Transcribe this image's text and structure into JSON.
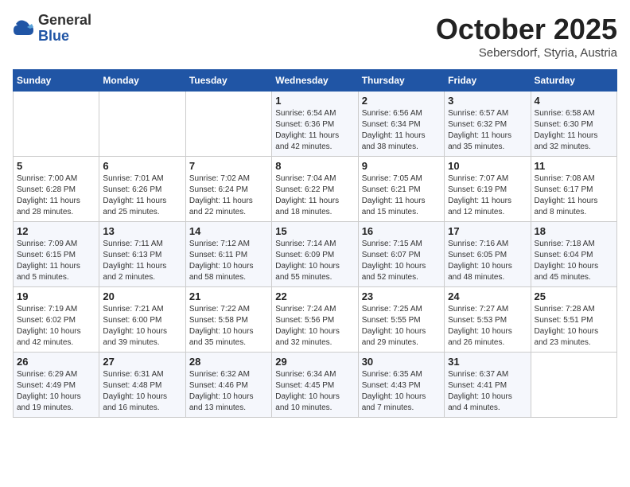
{
  "header": {
    "logo_line1": "General",
    "logo_line2": "Blue",
    "month": "October 2025",
    "location": "Sebersdorf, Styria, Austria"
  },
  "weekdays": [
    "Sunday",
    "Monday",
    "Tuesday",
    "Wednesday",
    "Thursday",
    "Friday",
    "Saturday"
  ],
  "weeks": [
    [
      {
        "day": "",
        "info": ""
      },
      {
        "day": "",
        "info": ""
      },
      {
        "day": "",
        "info": ""
      },
      {
        "day": "1",
        "info": "Sunrise: 6:54 AM\nSunset: 6:36 PM\nDaylight: 11 hours\nand 42 minutes."
      },
      {
        "day": "2",
        "info": "Sunrise: 6:56 AM\nSunset: 6:34 PM\nDaylight: 11 hours\nand 38 minutes."
      },
      {
        "day": "3",
        "info": "Sunrise: 6:57 AM\nSunset: 6:32 PM\nDaylight: 11 hours\nand 35 minutes."
      },
      {
        "day": "4",
        "info": "Sunrise: 6:58 AM\nSunset: 6:30 PM\nDaylight: 11 hours\nand 32 minutes."
      }
    ],
    [
      {
        "day": "5",
        "info": "Sunrise: 7:00 AM\nSunset: 6:28 PM\nDaylight: 11 hours\nand 28 minutes."
      },
      {
        "day": "6",
        "info": "Sunrise: 7:01 AM\nSunset: 6:26 PM\nDaylight: 11 hours\nand 25 minutes."
      },
      {
        "day": "7",
        "info": "Sunrise: 7:02 AM\nSunset: 6:24 PM\nDaylight: 11 hours\nand 22 minutes."
      },
      {
        "day": "8",
        "info": "Sunrise: 7:04 AM\nSunset: 6:22 PM\nDaylight: 11 hours\nand 18 minutes."
      },
      {
        "day": "9",
        "info": "Sunrise: 7:05 AM\nSunset: 6:21 PM\nDaylight: 11 hours\nand 15 minutes."
      },
      {
        "day": "10",
        "info": "Sunrise: 7:07 AM\nSunset: 6:19 PM\nDaylight: 11 hours\nand 12 minutes."
      },
      {
        "day": "11",
        "info": "Sunrise: 7:08 AM\nSunset: 6:17 PM\nDaylight: 11 hours\nand 8 minutes."
      }
    ],
    [
      {
        "day": "12",
        "info": "Sunrise: 7:09 AM\nSunset: 6:15 PM\nDaylight: 11 hours\nand 5 minutes."
      },
      {
        "day": "13",
        "info": "Sunrise: 7:11 AM\nSunset: 6:13 PM\nDaylight: 11 hours\nand 2 minutes."
      },
      {
        "day": "14",
        "info": "Sunrise: 7:12 AM\nSunset: 6:11 PM\nDaylight: 10 hours\nand 58 minutes."
      },
      {
        "day": "15",
        "info": "Sunrise: 7:14 AM\nSunset: 6:09 PM\nDaylight: 10 hours\nand 55 minutes."
      },
      {
        "day": "16",
        "info": "Sunrise: 7:15 AM\nSunset: 6:07 PM\nDaylight: 10 hours\nand 52 minutes."
      },
      {
        "day": "17",
        "info": "Sunrise: 7:16 AM\nSunset: 6:05 PM\nDaylight: 10 hours\nand 48 minutes."
      },
      {
        "day": "18",
        "info": "Sunrise: 7:18 AM\nSunset: 6:04 PM\nDaylight: 10 hours\nand 45 minutes."
      }
    ],
    [
      {
        "day": "19",
        "info": "Sunrise: 7:19 AM\nSunset: 6:02 PM\nDaylight: 10 hours\nand 42 minutes."
      },
      {
        "day": "20",
        "info": "Sunrise: 7:21 AM\nSunset: 6:00 PM\nDaylight: 10 hours\nand 39 minutes."
      },
      {
        "day": "21",
        "info": "Sunrise: 7:22 AM\nSunset: 5:58 PM\nDaylight: 10 hours\nand 35 minutes."
      },
      {
        "day": "22",
        "info": "Sunrise: 7:24 AM\nSunset: 5:56 PM\nDaylight: 10 hours\nand 32 minutes."
      },
      {
        "day": "23",
        "info": "Sunrise: 7:25 AM\nSunset: 5:55 PM\nDaylight: 10 hours\nand 29 minutes."
      },
      {
        "day": "24",
        "info": "Sunrise: 7:27 AM\nSunset: 5:53 PM\nDaylight: 10 hours\nand 26 minutes."
      },
      {
        "day": "25",
        "info": "Sunrise: 7:28 AM\nSunset: 5:51 PM\nDaylight: 10 hours\nand 23 minutes."
      }
    ],
    [
      {
        "day": "26",
        "info": "Sunrise: 6:29 AM\nSunset: 4:49 PM\nDaylight: 10 hours\nand 19 minutes."
      },
      {
        "day": "27",
        "info": "Sunrise: 6:31 AM\nSunset: 4:48 PM\nDaylight: 10 hours\nand 16 minutes."
      },
      {
        "day": "28",
        "info": "Sunrise: 6:32 AM\nSunset: 4:46 PM\nDaylight: 10 hours\nand 13 minutes."
      },
      {
        "day": "29",
        "info": "Sunrise: 6:34 AM\nSunset: 4:45 PM\nDaylight: 10 hours\nand 10 minutes."
      },
      {
        "day": "30",
        "info": "Sunrise: 6:35 AM\nSunset: 4:43 PM\nDaylight: 10 hours\nand 7 minutes."
      },
      {
        "day": "31",
        "info": "Sunrise: 6:37 AM\nSunset: 4:41 PM\nDaylight: 10 hours\nand 4 minutes."
      },
      {
        "day": "",
        "info": ""
      }
    ]
  ]
}
